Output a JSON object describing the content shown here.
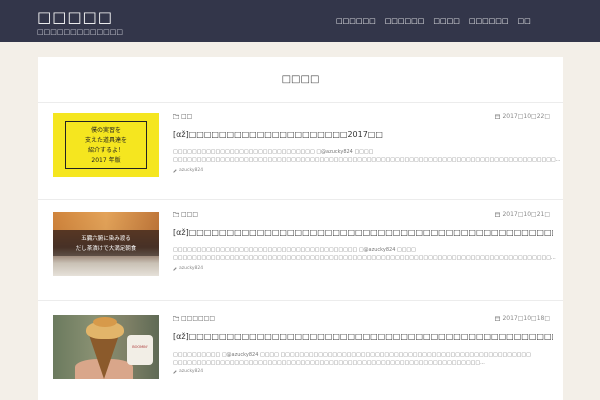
{
  "site": {
    "title": "□□□□□",
    "description": "□□□□□□□□□□□□□"
  },
  "nav": {
    "items": [
      "□□□□□□",
      "□□□□□□",
      "□□□□",
      "□□□□□□",
      "□□"
    ]
  },
  "page": {
    "title": "□□□□"
  },
  "entries": [
    {
      "category": "□□",
      "date": "2017□10□22□",
      "title": "[αž]□□□□□□□□□□□□□□□□□□□□□2017□□",
      "excerpt": "□□□□□□□□□□□□□□□□□□□□□□□□□□□□□□ □@azucky824 □□□□ □□□□□□□□□□□□□□□□□□□□□□□□□□□□□□□□□□□□□□□□□□□□□□□□□□□□□□□□□□□□□□□□□□□□□□□□□□□□□□□□□...",
      "author": "azucky824",
      "thumb_lines": [
        "僕の実習を",
        "支えた道具達を",
        "紹介するよ！",
        "2017 年版"
      ]
    },
    {
      "category": "□□□",
      "date": "2017□10□21□",
      "title": "[αž]□□□□□□□□□□□□□□□□□□□□□□□□□□□□□□□□□□□□□□□□□□□□□□□□□□□",
      "excerpt": "□□□□□□□□□□□□□□□□□□□□□□□□□□□□□□□□□□□□□□□ □@azucky824 □□□□ □□□□□□□□□□□□□□□□□□□□□□□□□□□□□□□□□□□□□□□□□□□□□□□□□□□□□□□□□□□□□□□□□□□□□□□□□□□□□□□□...",
      "author": "azucky824",
      "thumb_lines": [
        "五臓六腑に染み渡る",
        "だし茶漬けで大満足朝食"
      ]
    },
    {
      "category": "□□□□□□",
      "date": "2017□10□18□",
      "title": "[αž]□□□□□□□□□□□□□□□□□□□□□□□□□□□□□□□□□□□□□□□□□□□□□□□□□□□□□□",
      "excerpt": "□□□□□□□□□□ □@azucky824 □□□□ □□□□□□□□□□□□□□□□□□□□□□□□□□□□□□□□□□□□□□□□□□□□□□□□□□□□□ □□□□□□□□□□□□□□□□□□□□□□□□□□□□□□□□□□□□□□□□□□□□□□□□□□□□□□□□□□□□□□□□□...",
      "author": "azucky824",
      "thumb_lines": [
        "BOOMIN'"
      ]
    }
  ],
  "icons": {
    "folder": "folder-icon",
    "calendar": "calendar-icon",
    "pencil": "pencil-icon"
  },
  "colors": {
    "header_bg": "#33364a",
    "page_bg": "#f3efe8",
    "card_bg": "#ffffff",
    "thumb_yellow": "#f5e61f"
  }
}
